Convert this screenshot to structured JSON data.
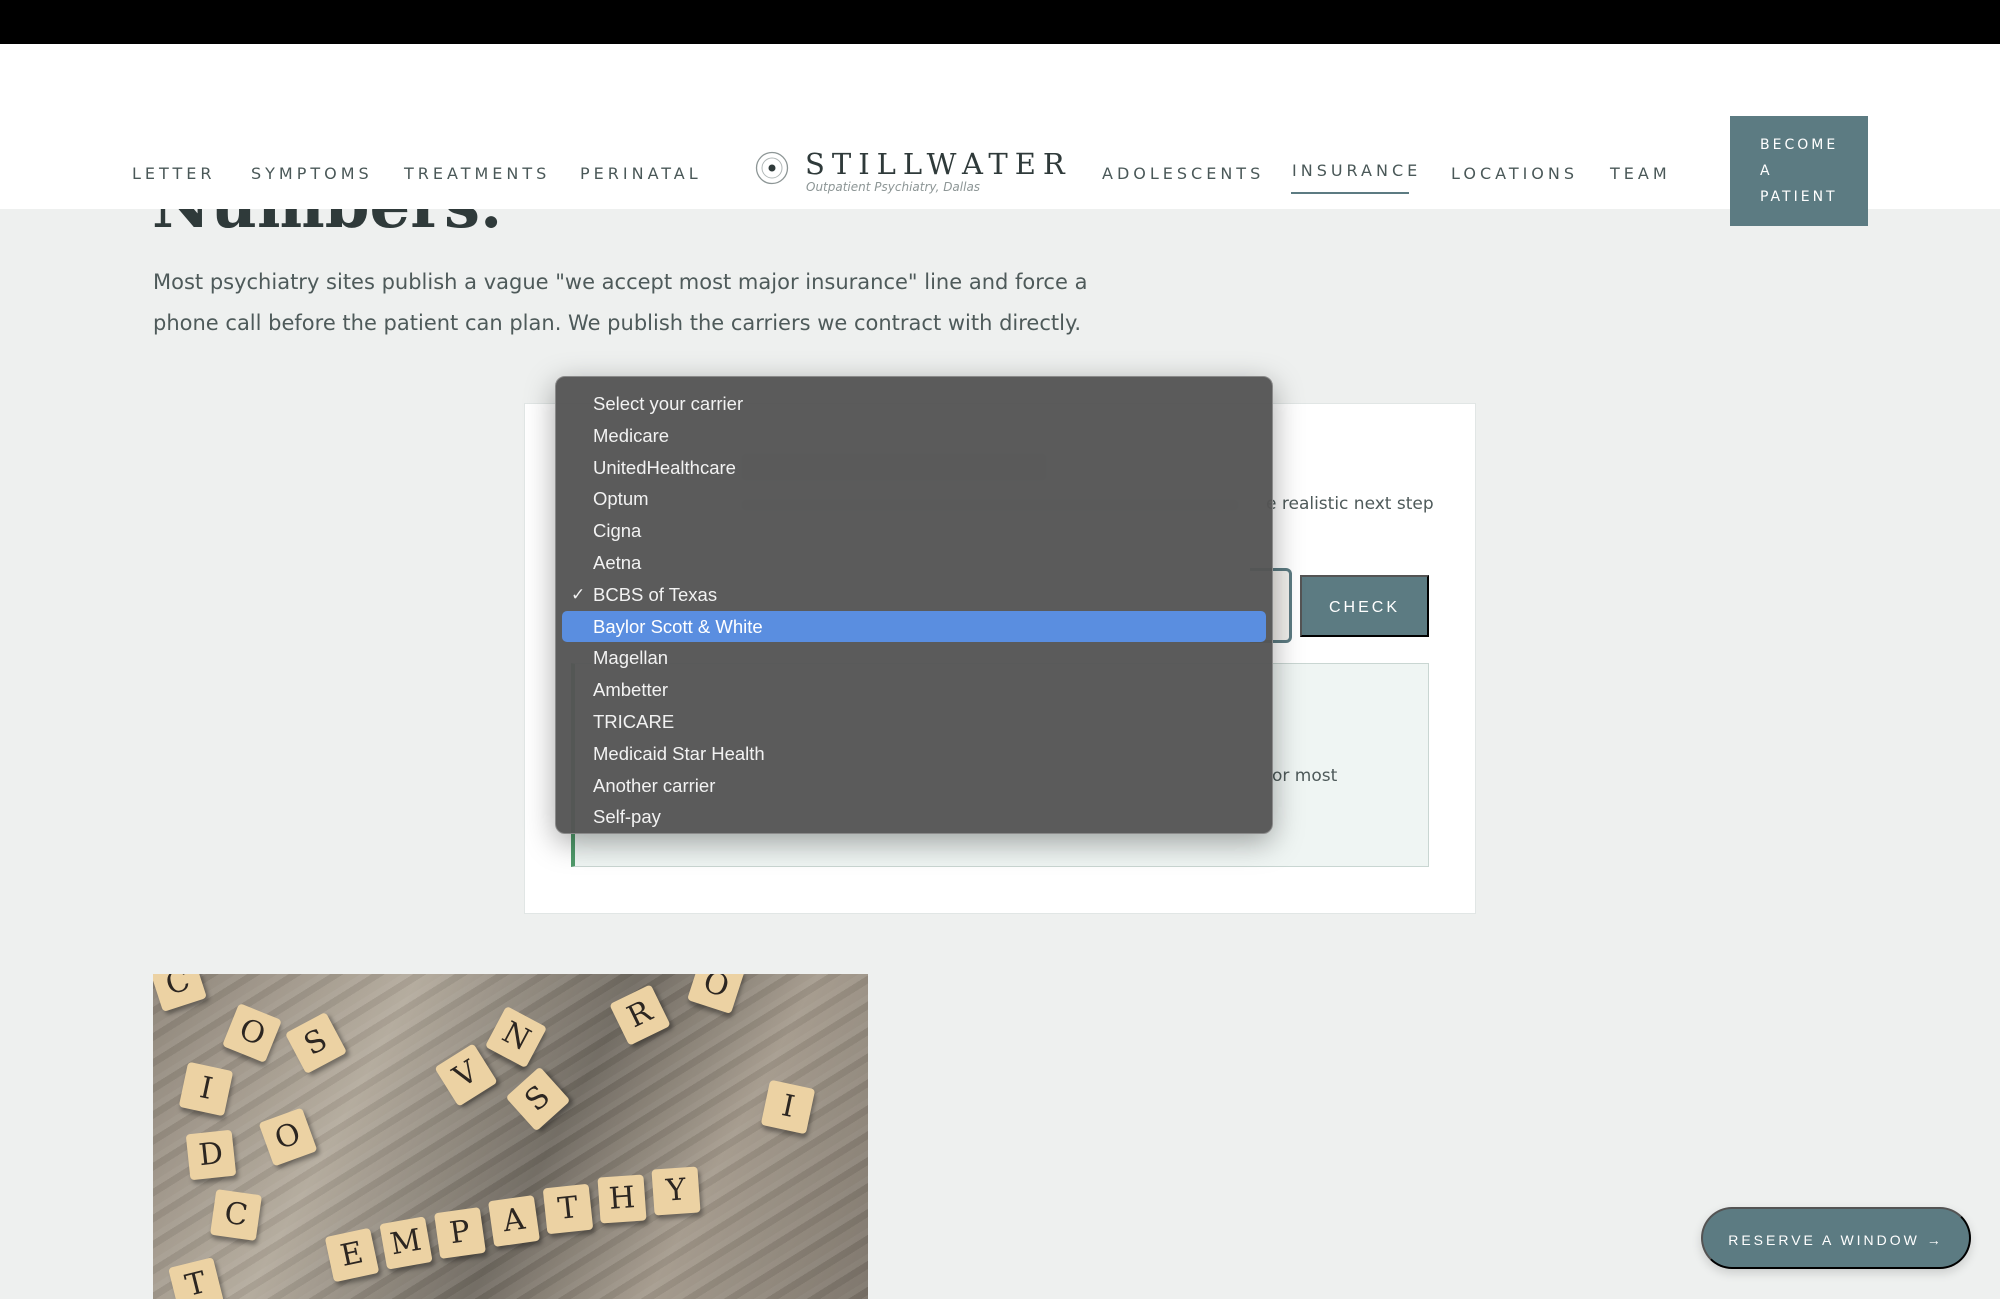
{
  "header": {
    "nav_left": [
      "LETTER",
      "SYMPTOMS",
      "TREATMENTS",
      "PERINATAL"
    ],
    "nav_right": [
      "ADOLESCENTS",
      "INSURANCE",
      "LOCATIONS",
      "TEAM"
    ],
    "active_nav": "INSURANCE",
    "logo_name": "STILLWATER",
    "logo_subtitle": "Outpatient Psychiatry, Dallas",
    "cta_label": "BECOME\nA\nPATIENT"
  },
  "main": {
    "heading_fragment": "Numbers.",
    "intro": "Most psychiatry sites publish a vague \"we accept most major insurance\" line and force a phone call before the patient can plan. We publish the carriers we contract with directly."
  },
  "checker": {
    "description_tail": "e realistic next step",
    "check_label": "CHECK",
    "result_tail": "or most"
  },
  "dropdown": {
    "options": [
      "Select your carrier",
      "Medicare",
      "UnitedHealthcare",
      "Optum",
      "Cigna",
      "Aetna",
      "BCBS of Texas",
      "Baylor Scott & White",
      "Magellan",
      "Ambetter",
      "TRICARE",
      "Medicaid Star Health",
      "Another carrier",
      "Self-pay"
    ],
    "checked": "BCBS of Texas",
    "highlighted": "Baylor Scott & White",
    "check_glyph": "✓"
  },
  "image": {
    "tiles": [
      "C",
      "O",
      "S",
      "I",
      "D",
      "O",
      "C",
      "V",
      "N",
      "S",
      "R",
      "O",
      "I",
      "T",
      "E",
      "M",
      "P",
      "A",
      "T",
      "H",
      "Y"
    ]
  },
  "floating": {
    "reserve_label": "RESERVE A WINDOW →"
  },
  "colors": {
    "accent": "#5c7b82",
    "highlight": "#5a8ee0",
    "page_bg": "#eef0ef"
  }
}
